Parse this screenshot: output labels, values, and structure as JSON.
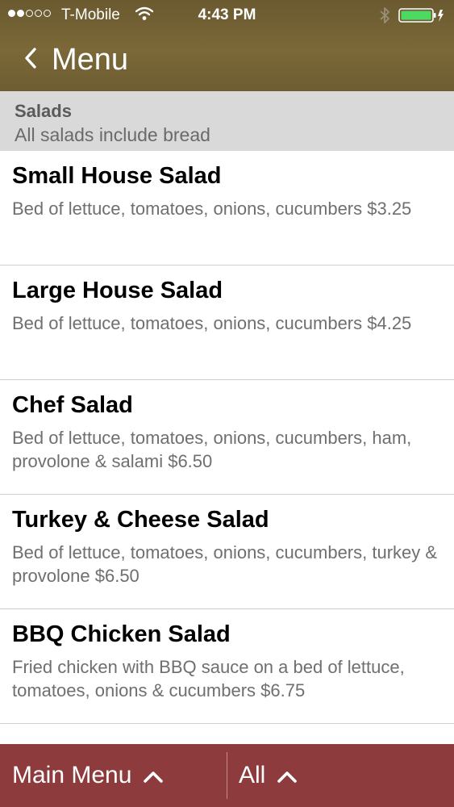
{
  "status_bar": {
    "carrier": "T-Mobile",
    "time": "4:43 PM",
    "signal_bars_filled": 2,
    "signal_bars_total": 5,
    "wifi_icon": "wifi-icon",
    "bluetooth_icon": "bluetooth-icon",
    "battery_icon": "battery-charging-icon"
  },
  "nav": {
    "back_icon": "chevron-left-icon",
    "title": "Menu"
  },
  "section": {
    "title": "Salads",
    "subtitle": "All salads include bread"
  },
  "items": [
    {
      "name": "Small House Salad",
      "description": "Bed of lettuce, tomatoes, onions, cucumbers $3.25"
    },
    {
      "name": "Large House Salad",
      "description": "Bed of lettuce, tomatoes, onions, cucumbers $4.25"
    },
    {
      "name": "Chef Salad",
      "description": "Bed of lettuce, tomatoes, onions, cucumbers, ham, provolone & salami $6.50"
    },
    {
      "name": "Turkey & Cheese Salad",
      "description": "Bed of lettuce, tomatoes, onions, cucumbers, turkey & provolone $6.50"
    },
    {
      "name": "BBQ Chicken Salad",
      "description": "Fried chicken with BBQ sauce on a bed of lettuce, tomatoes, onions & cucumbers $6.75"
    }
  ],
  "bottom_bar": {
    "main_menu_label": "Main Menu",
    "all_label": "All",
    "chevron_icon": "chevron-up-icon"
  },
  "colors": {
    "header": "#75643a",
    "section_header": "#d9d9d9",
    "bottom_bar": "#8e3b3d",
    "battery": "#4cd964"
  }
}
